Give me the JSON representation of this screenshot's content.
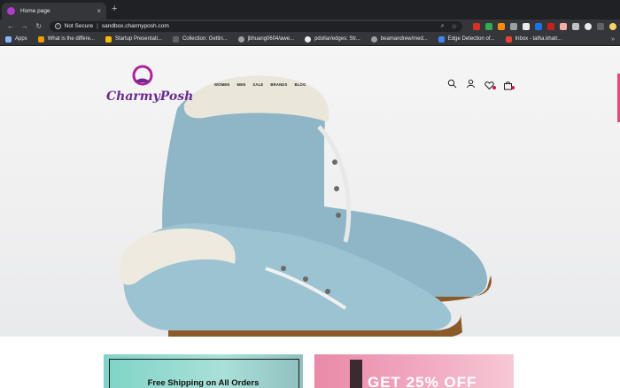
{
  "browser": {
    "tab_title": "Home page",
    "tab_close": "×",
    "new_tab": "+",
    "security_label": "Not Secure",
    "url": "sandbox.charmyposh.com",
    "bookmarks": [
      {
        "label": "Apps",
        "color": "#8ab4f8"
      },
      {
        "label": "What is the differe...",
        "color": "#f29900"
      },
      {
        "label": "Startup Presentati...",
        "color": "#fbbc04"
      },
      {
        "label": "Collection: Gettin...",
        "color": "#5f6368"
      },
      {
        "label": "jbhuang0604/awe...",
        "color": "#202124"
      },
      {
        "label": "pdollar/edges: Str...",
        "color": "#e8eaed"
      },
      {
        "label": "beamandrew/med...",
        "color": "#202124"
      },
      {
        "label": "Edge Detection of...",
        "color": "#4285f4"
      },
      {
        "label": "Inbox - talha.khatr...",
        "color": "#ea4335"
      }
    ],
    "bookmarks_more": "»"
  },
  "site": {
    "logo_text": "CharmyPosh",
    "nav": [
      "WOMEN",
      "MEN",
      "SALE",
      "BRANDS",
      "BLOG"
    ],
    "brand_color": "#6a2d8f",
    "accent_color": "#c3184f"
  },
  "promos": {
    "left_text": "Free Shipping on All Orders",
    "right_text": "GET 25% OFF"
  }
}
